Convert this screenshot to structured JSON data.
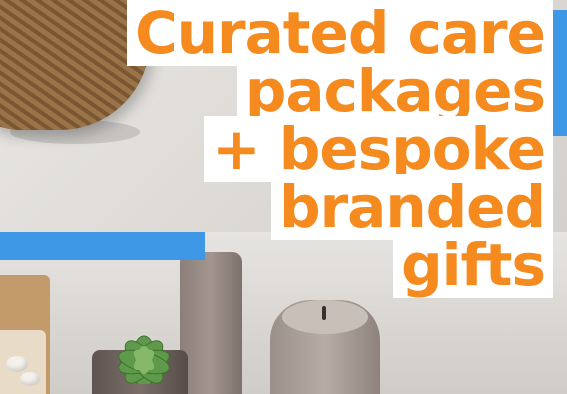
{
  "headline": {
    "lines": [
      "Curated care",
      "packages",
      "+ bespoke",
      "branded",
      "gifts"
    ]
  },
  "colors": {
    "headline_text": "#f58a1f",
    "headline_background": "#ffffff",
    "accent_blue": "#3e98e6"
  }
}
